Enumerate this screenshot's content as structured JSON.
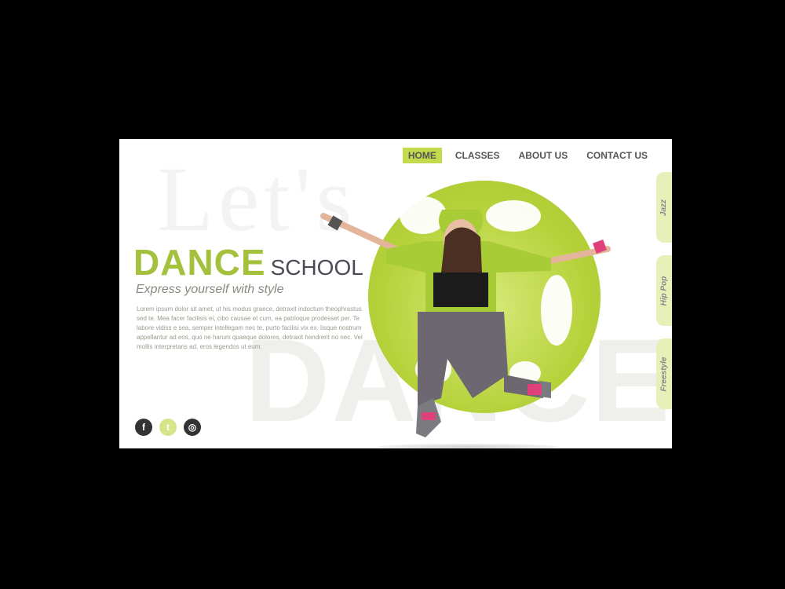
{
  "background": {
    "lets": "Let's",
    "dance": "DANCE"
  },
  "nav": [
    {
      "label": "HOME",
      "active": true
    },
    {
      "label": "CLASSES",
      "active": false
    },
    {
      "label": "ABOUT US",
      "active": false
    },
    {
      "label": "CONTACT US",
      "active": false
    }
  ],
  "hero": {
    "title_big": "DANCE",
    "title_small": "SCHOOL",
    "tagline": "Express yourself with style",
    "description": "Lorem ipsum dolor sit amet, ut his modus graece, detraxit indoctum theophrastus sed te. Mea facer facilisis ei, cibo causae et cum, ea patrioque prodesset per. Te labore vidiss e sea, semper intellegam nec te, purto facilisi vix ex. Iisque nostrum appellantur ad eos, quo ne harum quaeque dolores, detraxit hendrerit no nec. Vel mollis interpretaris ad, eros legendos ut eum."
  },
  "side_tabs": [
    "Jazz",
    "Hip Pop",
    "Freestyle"
  ],
  "social": [
    {
      "icon": "facebook-icon",
      "glyph": "f"
    },
    {
      "icon": "twitter-icon",
      "glyph": "t"
    },
    {
      "icon": "instagram-icon",
      "glyph": "◎"
    }
  ],
  "colors": {
    "accent": "#a3c13c",
    "nav_active": "#c3da4c",
    "tab": "#e6f0b8"
  }
}
